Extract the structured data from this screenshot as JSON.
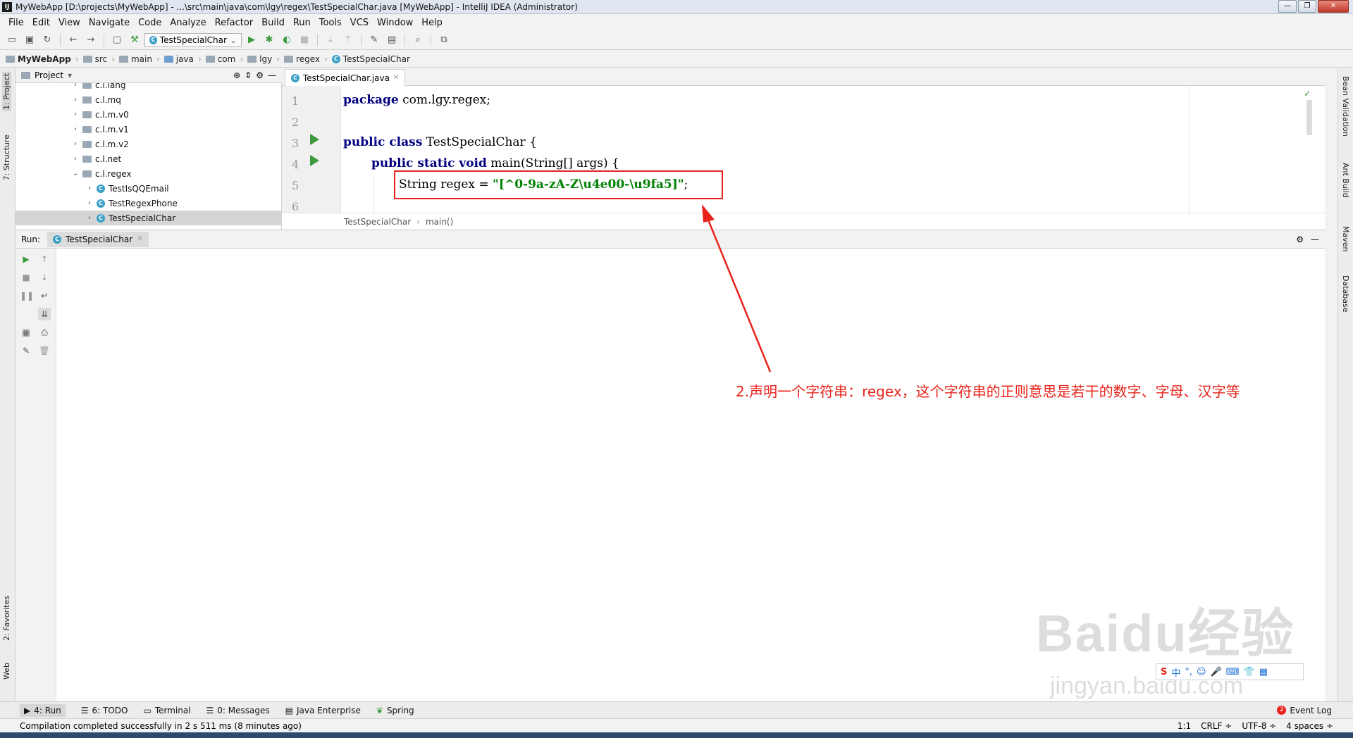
{
  "window": {
    "title": "MyWebApp [D:\\projects\\MyWebApp] - ...\\src\\main\\java\\com\\lgy\\regex\\TestSpecialChar.java [MyWebApp] - IntelliJ IDEA (Administrator)"
  },
  "menu": [
    "File",
    "Edit",
    "View",
    "Navigate",
    "Code",
    "Analyze",
    "Refactor",
    "Build",
    "Run",
    "Tools",
    "VCS",
    "Window",
    "Help"
  ],
  "toolbar": {
    "run_config": "TestSpecialChar"
  },
  "breadcrumb": [
    "MyWebApp",
    "src",
    "main",
    "java",
    "com",
    "lgy",
    "regex",
    "TestSpecialChar"
  ],
  "left_tabs": [
    "1: Project",
    "7: Structure",
    "2: Favorites",
    "Web"
  ],
  "right_tabs": [
    "Bean Validation",
    "Ant Build",
    "Maven",
    "Database"
  ],
  "project": {
    "header": "Project",
    "tree": [
      {
        "label": "c.l.lang",
        "type": "package"
      },
      {
        "label": "c.l.mq",
        "type": "package"
      },
      {
        "label": "c.l.m.v0",
        "type": "package"
      },
      {
        "label": "c.l.m.v1",
        "type": "package"
      },
      {
        "label": "c.l.m.v2",
        "type": "package"
      },
      {
        "label": "c.l.net",
        "type": "package"
      },
      {
        "label": "c.l.regex",
        "type": "package"
      },
      {
        "label": "TestIsQQEmail",
        "type": "class"
      },
      {
        "label": "TestRegexPhone",
        "type": "class"
      },
      {
        "label": "TestSpecialChar",
        "type": "class"
      }
    ]
  },
  "editor": {
    "tab": "TestSpecialChar.java",
    "line_numbers": [
      "1",
      "2",
      "3",
      "4",
      "5",
      "6"
    ],
    "line1": {
      "kw": "package",
      "rest": " com.lgy.regex;"
    },
    "line3": {
      "kw": "public class",
      "rest": " TestSpecialChar {"
    },
    "line4": {
      "kw": "public static void",
      "rest": " main(String[] args) {"
    },
    "line5": {
      "type": "String regex = ",
      "str": "\"[^0-9a-zA-Z\\u4e00-\\u9fa5]\"",
      "end": ";"
    },
    "crumbs": [
      "TestSpecialChar",
      "main()"
    ]
  },
  "run": {
    "label": "Run:",
    "tab": "TestSpecialChar"
  },
  "annotation": "2.声明一个字符串：regex，这个字符串的正则意思是若干的数字、字母、汉字等",
  "watermark": {
    "main": "Baidu经验",
    "sub": "jingyan.baidu.com"
  },
  "ime": "中",
  "bottom_tabs": [
    "4: Run",
    "6: TODO",
    "Terminal",
    "0: Messages",
    "Java Enterprise",
    "Spring"
  ],
  "event_log": "Event Log",
  "event_count": "2",
  "status": {
    "message": "Compilation completed successfully in 2 s 511 ms (8 minutes ago)",
    "position": "1:1",
    "line_sep": "CRLF ÷",
    "encoding": "UTF-8 ÷",
    "indent": "4 spaces ÷"
  },
  "colors": {
    "accent_red": "#e8231b",
    "keyword": "#000080",
    "string": "#008000"
  }
}
